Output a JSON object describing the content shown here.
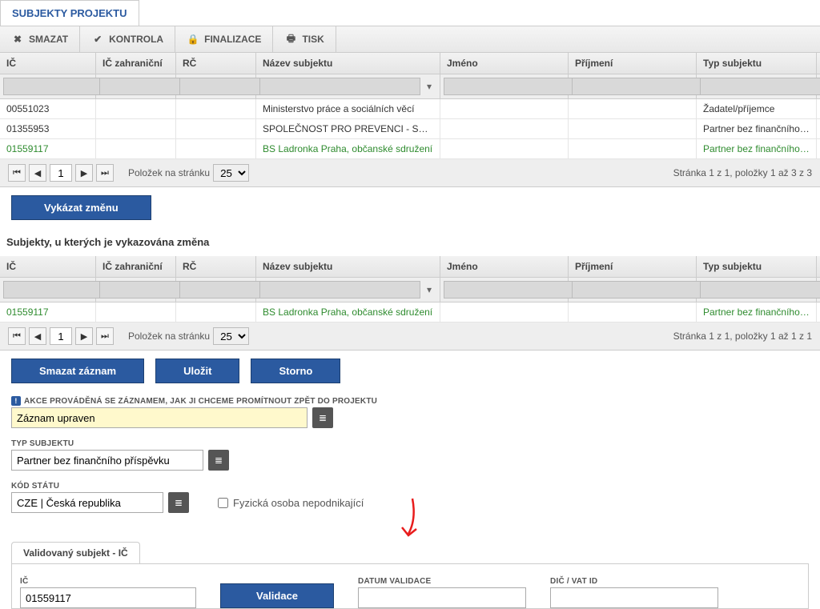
{
  "tab": "SUBJEKTY PROJEKTU",
  "toolbar": {
    "smazat": "SMAZAT",
    "kontrola": "KONTROLA",
    "finalizace": "FINALIZACE",
    "tisk": "TISK"
  },
  "cols": {
    "ic": "IČ",
    "ic_zahr": "IČ zahraniční",
    "rc": "RČ",
    "nazev": "Název subjektu",
    "jmeno": "Jméno",
    "prijmeni": "Příjmení",
    "typ": "Typ subjektu"
  },
  "t1": {
    "rows": [
      {
        "ic": "00551023",
        "nazev": "Ministerstvo práce a sociálních věcí",
        "typ": "Žadatel/příjemce"
      },
      {
        "ic": "01355953",
        "nazev": "SPOLEČNOST PRO PREVENCI - SOCIETY...",
        "typ": "Partner bez finančního p..."
      },
      {
        "ic": "01559117",
        "nazev": "BS Ladronka Praha, občanské sdružení",
        "typ": "Partner bez finančního p..."
      }
    ]
  },
  "pager": {
    "page": "1",
    "polozek_label": "Položek na stránku",
    "per_page": "25",
    "summary1": "Stránka 1 z 1, položky 1 až 3 z 3",
    "summary2": "Stránka 1 z 1, položky 1 až 1 z 1"
  },
  "btn_vykazat": "Vykázat změnu",
  "section2": "Subjekty, u kterých je vykazována změna",
  "t2_row": {
    "ic": "01559117",
    "nazev": "BS Ladronka Praha, občanské sdružení",
    "typ": "Partner bez finančního p..."
  },
  "form_btns": {
    "smazat": "Smazat záznam",
    "ulozit": "Uložit",
    "storno": "Storno"
  },
  "fields": {
    "akce_label": "AKCE PROVÁDĚNÁ SE ZÁZNAMEM, JAK JI CHCEME PROMÍTNOUT ZPĚT DO PROJEKTU",
    "akce_value": "Záznam upraven",
    "typ_label": "TYP SUBJEKTU",
    "typ_value": "Partner bez finančního příspěvku",
    "kod_label": "KÓD STÁTU",
    "kod_value": "CZE | Česká republika",
    "checkbox": "Fyzická osoba nepodnikající"
  },
  "validace": {
    "tab": "Validovaný subjekt - IČ",
    "ic_label": "IČ",
    "ic_value": "01559117",
    "btn": "Validace",
    "datum_label": "DATUM VALIDACE",
    "dic_label": "DIČ / VAT ID"
  }
}
